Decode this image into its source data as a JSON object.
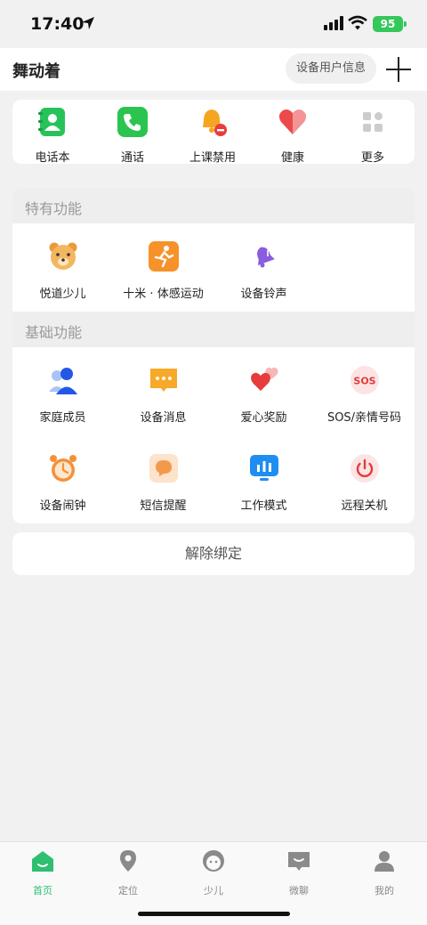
{
  "status_bar": {
    "time": "17:40",
    "battery": "95",
    "location_icon": "location-arrow-icon",
    "signal_icon": "cellular-signal-icon",
    "wifi_icon": "wifi-icon"
  },
  "header": {
    "title": "舞动着",
    "device_info_button": "设备用户信息",
    "add_icon": "plus-icon"
  },
  "quick_actions": [
    {
      "label": "电话本",
      "icon": "phonebook-icon",
      "color": "#27c35a"
    },
    {
      "label": "通话",
      "icon": "phone-call-icon",
      "color": "#2ac44f"
    },
    {
      "label": "上课禁用",
      "icon": "bell-disabled-icon",
      "color": "#f6a523"
    },
    {
      "label": "健康",
      "icon": "heart-icon",
      "color": "#ec4a4a"
    },
    {
      "label": "更多",
      "icon": "more-grid-icon",
      "color": "#cccccc"
    }
  ],
  "special_section": {
    "title": "特有功能",
    "items": [
      {
        "label": "悦道少儿",
        "icon": "bear-icon"
      },
      {
        "label": "十米 · 体感运动",
        "icon": "running-icon"
      },
      {
        "label": "设备铃声",
        "icon": "ringtone-bell-icon"
      }
    ]
  },
  "basic_section": {
    "title": "基础功能",
    "items": [
      {
        "label": "家庭成员",
        "icon": "family-members-icon"
      },
      {
        "label": "设备消息",
        "icon": "message-icon"
      },
      {
        "label": "爱心奖励",
        "icon": "love-reward-icon"
      },
      {
        "label": "SOS/亲情号码",
        "icon": "sos-icon"
      },
      {
        "label": "设备闹钟",
        "icon": "alarm-clock-icon"
      },
      {
        "label": "短信提醒",
        "icon": "sms-reminder-icon"
      },
      {
        "label": "工作模式",
        "icon": "work-mode-icon"
      },
      {
        "label": "远程关机",
        "icon": "power-icon"
      }
    ]
  },
  "unbind_button": "解除绑定",
  "tabs": [
    {
      "label": "首页",
      "icon": "home-icon",
      "active": true
    },
    {
      "label": "定位",
      "icon": "location-pin-icon",
      "active": false
    },
    {
      "label": "少儿",
      "icon": "kid-face-icon",
      "active": false
    },
    {
      "label": "微聊",
      "icon": "chat-icon",
      "active": false
    },
    {
      "label": "我的",
      "icon": "profile-icon",
      "active": false
    }
  ],
  "colors": {
    "accent": "#2fbf71",
    "background": "#f1f1f1"
  }
}
